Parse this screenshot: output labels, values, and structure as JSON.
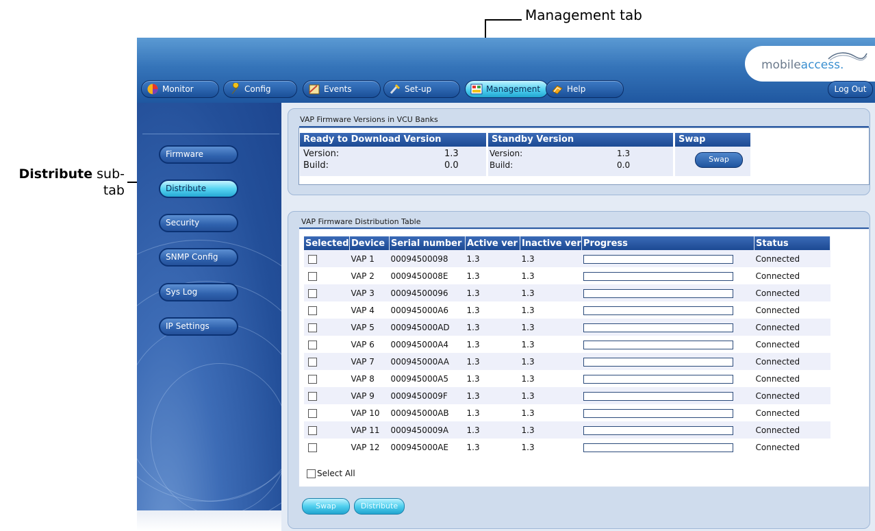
{
  "annotations": {
    "management_tab": "Management tab",
    "distribute_bold": "Distribute",
    "distribute_rest1": " sub-",
    "distribute_rest2": "tab"
  },
  "header": {
    "logo_pre": "mobile",
    "logo_accent": "access.",
    "tabs": [
      {
        "label": "Monitor",
        "icon": "monitor-icon"
      },
      {
        "label": "Config",
        "icon": "wrench-icon"
      },
      {
        "label": "Events",
        "icon": "events-icon"
      },
      {
        "label": "Set-up",
        "icon": "tools-icon"
      },
      {
        "label": "Management",
        "icon": "management-icon",
        "active": true
      },
      {
        "label": "Help",
        "icon": "help-book-icon"
      }
    ],
    "logout": "Log Out"
  },
  "sidebar": {
    "items": [
      {
        "label": "Firmware"
      },
      {
        "label": "Distribute",
        "active": true
      },
      {
        "label": "Security"
      },
      {
        "label": "SNMP Config"
      },
      {
        "label": "Sys Log"
      },
      {
        "label": "IP Settings"
      }
    ]
  },
  "firmware_panel": {
    "title": "VAP Firmware Versions in VCU Banks",
    "ready_header": "Ready to Download Version",
    "standby_header": "Standby Version",
    "swap_header": "Swap",
    "ready_version_label": "Version:",
    "ready_version_value": "1.3",
    "ready_build_label": "Build:",
    "ready_build_value": "0.0",
    "standby_version_label": "Version:",
    "standby_version_value": "1.3",
    "standby_build_label": "Build:",
    "standby_build_value": "0.0",
    "swap_button": "Swap"
  },
  "distribution_panel": {
    "title": "VAP Firmware Distribution Table",
    "columns": [
      "Selected",
      "Device",
      "Serial number",
      "Active ver",
      "Inactive ver",
      "Progress",
      "Status"
    ],
    "rows": [
      {
        "device": "VAP 1",
        "serial": "00094500098",
        "active": "1.3",
        "inactive": "1.3",
        "progress": 0,
        "status": "Connected"
      },
      {
        "device": "VAP 2",
        "serial": "0009450008E",
        "active": "1.3",
        "inactive": "1.3",
        "progress": 0,
        "status": "Connected"
      },
      {
        "device": "VAP 3",
        "serial": "00094500096",
        "active": "1.3",
        "inactive": "1.3",
        "progress": 0,
        "status": "Connected"
      },
      {
        "device": "VAP 4",
        "serial": "000945000A6",
        "active": "1.3",
        "inactive": "1.3",
        "progress": 0,
        "status": "Connected"
      },
      {
        "device": "VAP 5",
        "serial": "000945000AD",
        "active": "1.3",
        "inactive": "1.3",
        "progress": 0,
        "status": "Connected"
      },
      {
        "device": "VAP 6",
        "serial": "000945000A4",
        "active": "1.3",
        "inactive": "1.3",
        "progress": 0,
        "status": "Connected"
      },
      {
        "device": "VAP 7",
        "serial": "000945000AA",
        "active": "1.3",
        "inactive": "1.3",
        "progress": 0,
        "status": "Connected"
      },
      {
        "device": "VAP 8",
        "serial": "000945000A5",
        "active": "1.3",
        "inactive": "1.3",
        "progress": 0,
        "status": "Connected"
      },
      {
        "device": "VAP 9",
        "serial": "0009450009F",
        "active": "1.3",
        "inactive": "1.3",
        "progress": 0,
        "status": "Connected"
      },
      {
        "device": "VAP 10",
        "serial": "000945000AB",
        "active": "1.3",
        "inactive": "1.3",
        "progress": 0,
        "status": "Connected"
      },
      {
        "device": "VAP 11",
        "serial": "0009450009A",
        "active": "1.3",
        "inactive": "1.3",
        "progress": 0,
        "status": "Connected"
      },
      {
        "device": "VAP 12",
        "serial": "000945000AE",
        "active": "1.3",
        "inactive": "1.3",
        "progress": 0,
        "status": "Connected"
      }
    ],
    "select_all": "Select All",
    "swap_button": "Swap",
    "distribute_button": "Distribute"
  }
}
